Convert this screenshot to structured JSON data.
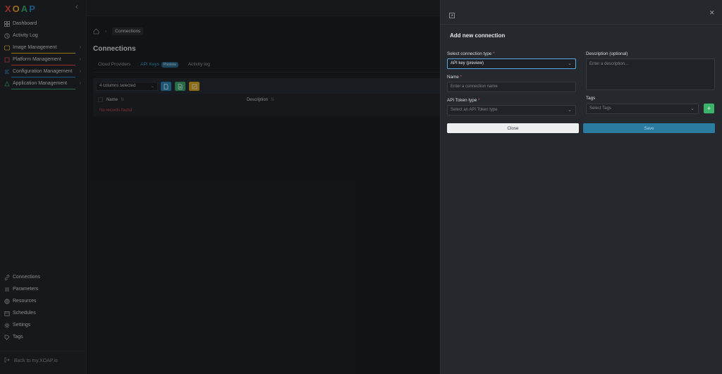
{
  "app": {
    "logo_letters": [
      "X",
      "O",
      "A",
      "P"
    ],
    "logo_colors": [
      "#e8493b",
      "#f4a524",
      "#3aa76d",
      "#2f86c9"
    ]
  },
  "sidebar": {
    "items": [
      {
        "label": "Dashboard",
        "icon": "dashboard-icon"
      },
      {
        "label": "Activity Log",
        "icon": "clock-icon"
      },
      {
        "label": "Image Management",
        "icon": "image-icon",
        "underline": "#e8b626"
      },
      {
        "label": "Platform Management",
        "icon": "platform-icon",
        "underline": "#e8493b"
      },
      {
        "label": "Configuration Management",
        "icon": "config-icon",
        "underline": "#2f86c9"
      },
      {
        "label": "Application Management",
        "icon": "app-icon",
        "underline": "#3aa76d"
      }
    ],
    "bottom_items": [
      {
        "label": "Connections",
        "icon": "link-icon"
      },
      {
        "label": "Parameters",
        "icon": "parameters-icon"
      },
      {
        "label": "Resources",
        "icon": "globe-icon"
      },
      {
        "label": "Schedules",
        "icon": "calendar-icon"
      },
      {
        "label": "Settings",
        "icon": "gear-icon"
      },
      {
        "label": "Tags",
        "icon": "tag-icon"
      }
    ],
    "back_label": "Back to my.XOAP.io"
  },
  "breadcrumb": {
    "current": "Connections"
  },
  "page": {
    "title": "Connections",
    "tabs": [
      {
        "label": "Cloud Providers"
      },
      {
        "label": "API Keys",
        "badge": "Preview"
      },
      {
        "label": "Activity log"
      }
    ],
    "columns_selected": "4 columns selected",
    "table": {
      "headers": [
        "Name",
        "Description"
      ],
      "empty_message": "No records found"
    }
  },
  "colors": {
    "accent": "#3a9ed0",
    "btn_blue": "#2a86b8",
    "btn_green": "#3aa76d",
    "btn_yellow": "#d9a520"
  },
  "drawer": {
    "title": "Add new connection",
    "connection_type_label": "Select connection type",
    "connection_type_value": "API key (preview)",
    "name_label": "Name",
    "name_placeholder": "Enter a connection name",
    "token_type_label": "API Token type",
    "token_type_placeholder": "Select an API Token type",
    "description_label": "Description (optional)",
    "description_placeholder": "Enter a description...",
    "tags_label": "Tags",
    "tags_placeholder": "Select Tags",
    "close_label": "Close",
    "save_label": "Save"
  }
}
